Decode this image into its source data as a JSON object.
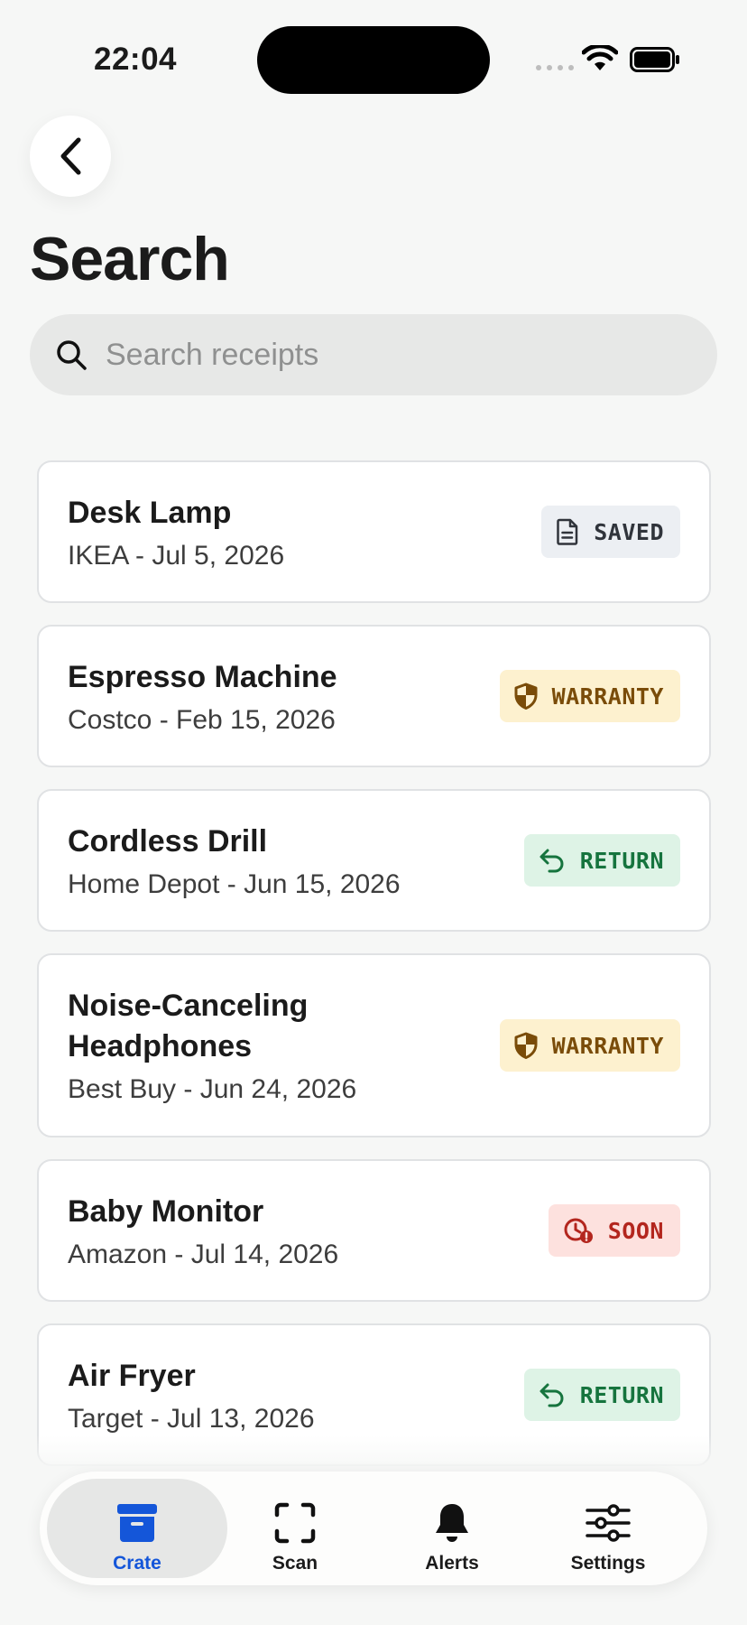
{
  "status_bar": {
    "time": "22:04"
  },
  "page": {
    "title": "Search"
  },
  "search": {
    "placeholder": "Search receipts",
    "value": ""
  },
  "receipts": [
    {
      "title": "Desk Lamp",
      "subtitle": "IKEA - Jul 5, 2026",
      "badge": "SAVED",
      "badge_icon": "document-icon"
    },
    {
      "title": "Espresso Machine",
      "subtitle": "Costco - Feb 15, 2026",
      "badge": "WARRANTY",
      "badge_icon": "shield-icon"
    },
    {
      "title": "Cordless Drill",
      "subtitle": "Home Depot - Jun 15, 2026",
      "badge": "RETURN",
      "badge_icon": "return-arrow-icon"
    },
    {
      "title": "Noise-Canceling Headphones",
      "subtitle": "Best Buy - Jun 24, 2026",
      "badge": "WARRANTY",
      "badge_icon": "shield-icon"
    },
    {
      "title": "Baby Monitor",
      "subtitle": "Amazon - Jul 14, 2026",
      "badge": "SOON",
      "badge_icon": "clock-alert-icon"
    },
    {
      "title": "Air Fryer",
      "subtitle": "Target - Jul 13, 2026",
      "badge": "RETURN",
      "badge_icon": "return-arrow-icon"
    }
  ],
  "tabs": [
    {
      "label": "Crate",
      "icon": "archive-box-icon",
      "active": true
    },
    {
      "label": "Scan",
      "icon": "scan-frame-icon",
      "active": false
    },
    {
      "label": "Alerts",
      "icon": "bell-icon",
      "active": false
    },
    {
      "label": "Settings",
      "icon": "sliders-icon",
      "active": false
    }
  ],
  "colors": {
    "accent": "#1456d9",
    "background": "#f6f7f6",
    "saved_bg": "#eceff3",
    "warranty_bg": "#fdf1cf",
    "warranty_fg": "#7a4c09",
    "return_bg": "#def3e6",
    "return_fg": "#16743e",
    "soon_bg": "#fde1de",
    "soon_fg": "#b3261e"
  }
}
